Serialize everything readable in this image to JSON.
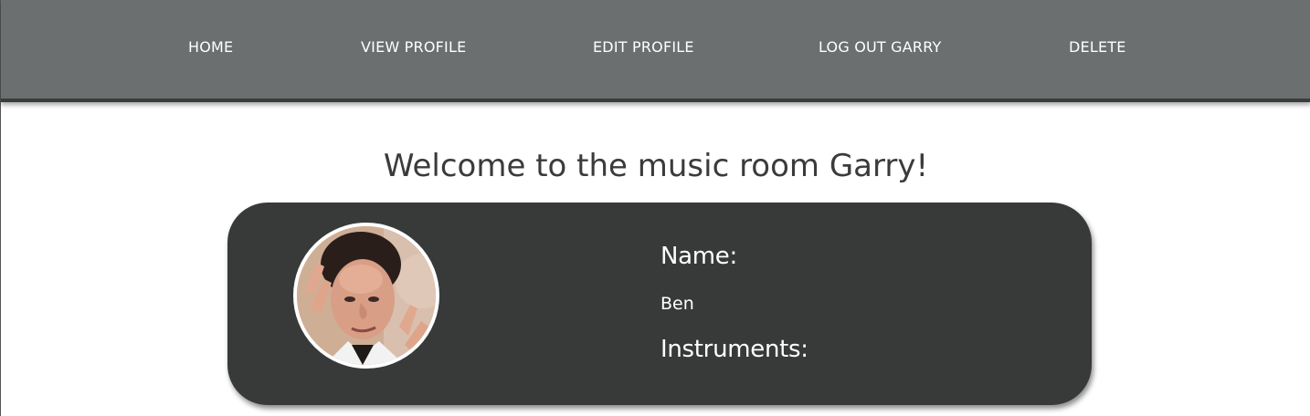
{
  "nav": {
    "home": "HOME",
    "view_profile": "VIEW PROFILE",
    "edit_profile": "EDIT PROFILE",
    "log_out": "LOG OUT GARRY",
    "delete": "DELETE"
  },
  "main": {
    "welcome": "Welcome to the music room Garry!"
  },
  "profile": {
    "name_label": "Name:",
    "name_value": "Ben",
    "instruments_label": "Instruments:"
  },
  "colors": {
    "navbar": "#6c6f70",
    "card": "#383a3a",
    "text_light": "#ffffff",
    "text_dark": "#3b3b3b"
  }
}
